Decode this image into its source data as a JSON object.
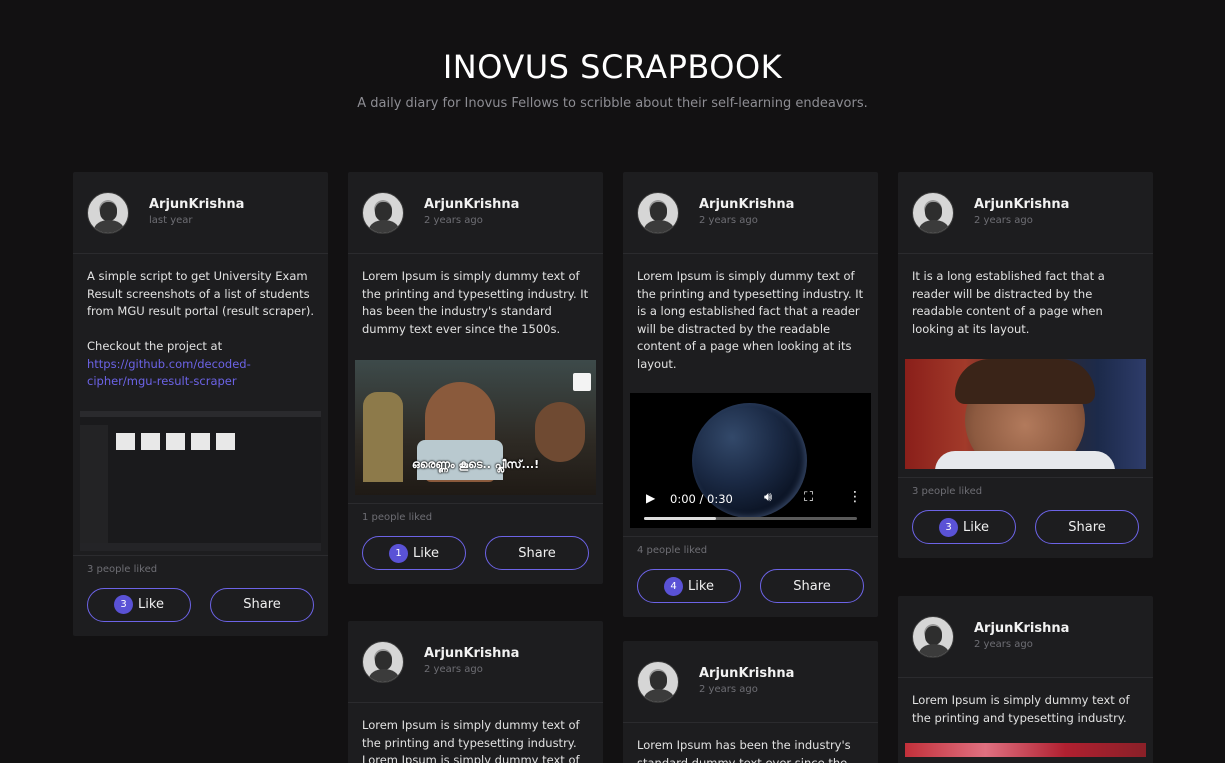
{
  "header": {
    "title": "INOVUS SCRAPBOOK",
    "subtitle": "A daily diary for Inovus Fellows to scribble about their self-learning endeavors."
  },
  "posts": [
    {
      "author": "ArjunKrishna",
      "time": "last year",
      "text1": "A simple script to get University Exam Result screenshots of a list of students from MGU result portal (result scraper).",
      "text2": "Checkout the project at",
      "link": "https://github.com/decoded-cipher/mgu-result-scraper",
      "media": "screenshot",
      "likes_text": "3 people liked",
      "like_count": "3",
      "like_label": "Like",
      "share_label": "Share"
    },
    {
      "author": "ArjunKrishna",
      "time": "2 years ago",
      "text1": "Lorem Ipsum is simply dummy text of the printing and typesetting industry. It has been the industry's standard dummy text ever since the 1500s.",
      "media": "meme",
      "caption": "ഒരെണ്ണം കൂടെ.. പ്ലീസ്...!",
      "likes_text": "1 people liked",
      "like_count": "1",
      "like_label": "Like",
      "share_label": "Share"
    },
    {
      "author": "ArjunKrishna",
      "time": "2 years ago",
      "text1": "Lorem Ipsum is simply dummy text of the printing and typesetting industry. It is a long established fact that a reader will be distracted by the readable content of a page when looking at its layout.",
      "media": "video",
      "video_time": "0:00 / 0:30",
      "video_progress": 0.34,
      "likes_text": "4 people liked",
      "like_count": "4",
      "like_label": "Like",
      "share_label": "Share"
    },
    {
      "author": "ArjunKrishna",
      "time": "2 years ago",
      "text1": "It is a long established fact that a reader will be distracted by the readable content of a page when looking at its layout.",
      "media": "image",
      "likes_text": "3 people liked",
      "like_count": "3",
      "like_label": "Like",
      "share_label": "Share"
    },
    {
      "author": "ArjunKrishna",
      "time": "2 years ago",
      "text1": "Lorem Ipsum is simply dummy text of the printing and typesetting industry. Lorem Ipsum is simply dummy text of"
    },
    {
      "author": "ArjunKrishna",
      "time": "2 years ago",
      "text1": "Lorem Ipsum has been the industry's standard dummy text ever since the"
    },
    {
      "author": "ArjunKrishna",
      "time": "2 years ago",
      "text1": "Lorem Ipsum is simply dummy text of the printing and typesetting industry.",
      "media": "image"
    }
  ],
  "colors": {
    "background": "#121112",
    "card": "#1d1d1f",
    "accent": "#6c63e6",
    "badge": "#5a52d6",
    "muted": "#6e6e74"
  }
}
